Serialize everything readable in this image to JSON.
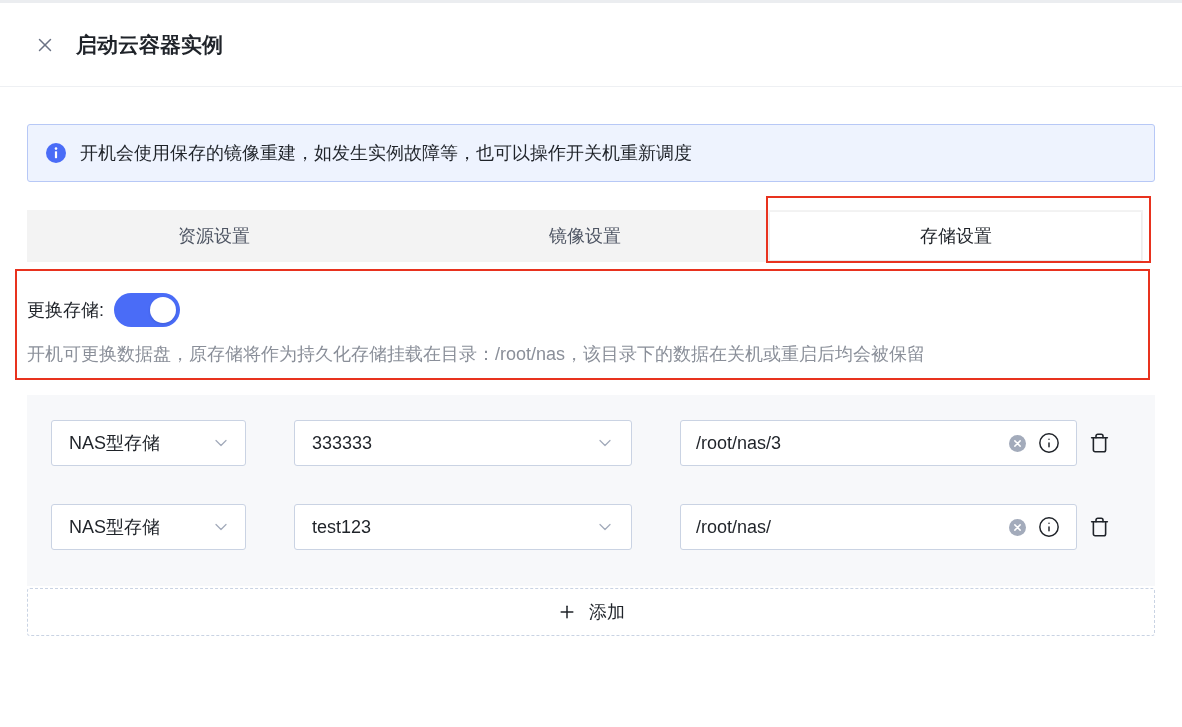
{
  "header": {
    "title": "启动云容器实例"
  },
  "alert": {
    "text": "开机会使用保存的镜像重建，如发生实例故障等，也可以操作开关机重新调度"
  },
  "tabs": [
    {
      "label": "资源设置",
      "selected": false
    },
    {
      "label": "镜像设置",
      "selected": false
    },
    {
      "label": "存储设置",
      "selected": true
    }
  ],
  "storage_switch": {
    "label": "更换存储:",
    "on": true,
    "description": "开机可更换数据盘，原存储将作为持久化存储挂载在目录：/root/nas，该目录下的数据在关机或重启后均会被保留"
  },
  "mounts": [
    {
      "type": "NAS型存储",
      "source": "333333",
      "path": "/root/nas/3"
    },
    {
      "type": "NAS型存储",
      "source": "test123",
      "path": "/root/nas/"
    }
  ],
  "add_button": {
    "label": "添加"
  }
}
